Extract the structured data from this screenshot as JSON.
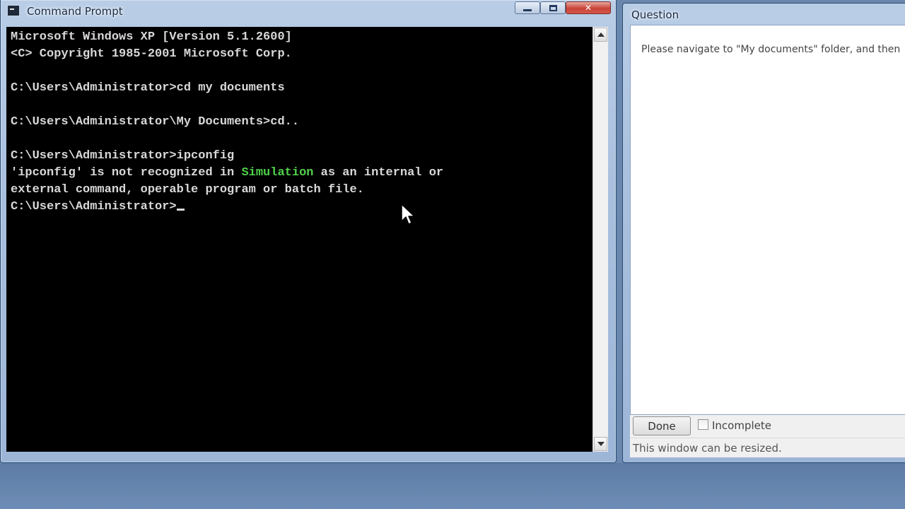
{
  "cmd_window": {
    "title": "Command Prompt",
    "console_lines": [
      "Microsoft Windows XP [Version 5.1.2600]",
      "<C> Copyright 1985-2001 Microsoft Corp.",
      "",
      "C:\\Users\\Administrator>cd my documents",
      "",
      "C:\\Users\\Administrator\\My Documents>cd..",
      "",
      "C:\\Users\\Administrator>ipconfig"
    ],
    "error_prefix": "'ipconfig' is not recognized in ",
    "error_highlight": "Simulation",
    "error_suffix": " as an internal or",
    "error_line2": "external command, operable program or batch file.",
    "prompt": "C:\\Users\\Administrator>"
  },
  "question_window": {
    "title": "Question",
    "question_text": "Please navigate to \"My documents\" folder, and then",
    "done_label": "Done",
    "incomplete_label": "Incomplete",
    "incomplete_checked": false,
    "status_text": "This window can be resized."
  },
  "colors": {
    "console_background": "#000000",
    "console_text": "#d8d8d8",
    "highlight_text": "#4fd14a",
    "close_button": "#c9453a"
  },
  "icons": {
    "app": "console-app-icon",
    "minimize": "minimize-icon",
    "maximize": "maximize-icon",
    "close": "close-icon",
    "scroll_up": "scroll-up-arrow-icon",
    "scroll_down": "scroll-down-arrow-icon",
    "pointer": "mouse-pointer-icon"
  }
}
